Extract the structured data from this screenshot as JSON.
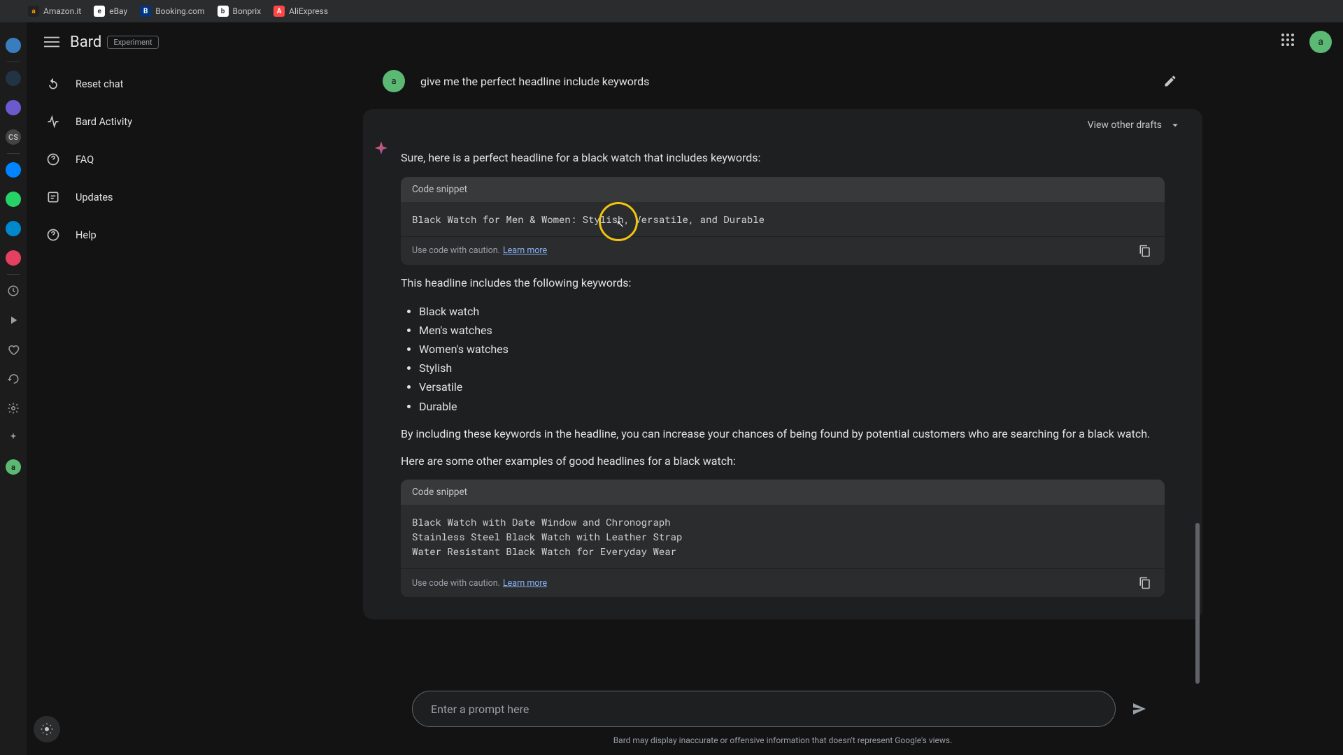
{
  "bookmarks": [
    {
      "label": "Amazon.it",
      "bg": "#222",
      "fg": "#ff9900",
      "letter": "a"
    },
    {
      "label": "eBay",
      "bg": "#fff",
      "fg": "#333",
      "letter": "e"
    },
    {
      "label": "Booking.com",
      "bg": "#003580",
      "fg": "#fff",
      "letter": "B"
    },
    {
      "label": "Bonprix",
      "bg": "#fff",
      "fg": "#333",
      "letter": "b"
    },
    {
      "label": "AliExpress",
      "bg": "#ff4747",
      "fg": "#fff",
      "letter": "A"
    }
  ],
  "appStrip": [
    {
      "bg": "#3a7dbf",
      "fg": "#fff",
      "name": "app-opera"
    },
    {
      "bg": "#234",
      "fg": "#8cf",
      "name": "app-chatgpt"
    },
    {
      "bg": "#6a5acd",
      "fg": "#fff",
      "name": "app-cortana"
    },
    {
      "bg": "#444",
      "fg": "#bbb",
      "name": "app-cs",
      "letter": "CS"
    },
    {
      "bg": "#0084ff",
      "fg": "#fff",
      "name": "app-messenger"
    },
    {
      "bg": "#25d366",
      "fg": "#fff",
      "name": "app-whatsapp"
    },
    {
      "bg": "#0088cc",
      "fg": "#fff",
      "name": "app-telegram"
    },
    {
      "bg": "#e4405f",
      "fg": "#fff",
      "name": "app-instagram"
    }
  ],
  "toolIcons": [
    "clock-icon",
    "play-icon",
    "heart-icon",
    "history-icon",
    "gear-icon",
    "sparkle-icon"
  ],
  "header": {
    "brand": "Bard",
    "badge": "Experiment",
    "avatarLetter": "a"
  },
  "sidebar": {
    "items": [
      {
        "label": "Reset chat",
        "icon": "reset"
      },
      {
        "label": "Bard Activity",
        "icon": "activity"
      },
      {
        "label": "FAQ",
        "icon": "faq"
      },
      {
        "label": "Updates",
        "icon": "updates"
      },
      {
        "label": "Help",
        "icon": "help"
      }
    ]
  },
  "conversation": {
    "userAvatar": "a",
    "userPrompt": "give me the perfect headline include keywords",
    "draftsLabel": "View other drafts",
    "intro": "Sure, here is a perfect headline for a black watch that includes keywords:",
    "snippet1": {
      "header": "Code snippet",
      "code": "Black Watch for Men & Women: Stylish, Versatile, and Durable",
      "caution": "Use code with caution.",
      "learn": "Learn more"
    },
    "keywordsIntro": "This headline includes the following keywords:",
    "keywords": [
      "Black watch",
      "Men's watches",
      "Women's watches",
      "Stylish",
      "Versatile",
      "Durable"
    ],
    "benefit": "By including these keywords in the headline, you can increase your chances of being found by potential customers who are searching for a black watch.",
    "examplesIntro": "Here are some other examples of good headlines for a black watch:",
    "snippet2": {
      "header": "Code snippet",
      "code": "Black Watch with Date Window and Chronograph\nStainless Steel Black Watch with Leather Strap\nWater Resistant Black Watch for Everyday Wear",
      "caution": "Use code with caution.",
      "learn": "Learn more"
    }
  },
  "prompt": {
    "placeholder": "Enter a prompt here"
  },
  "disclaimer": "Bard may display inaccurate or offensive information that doesn't represent Google's views."
}
